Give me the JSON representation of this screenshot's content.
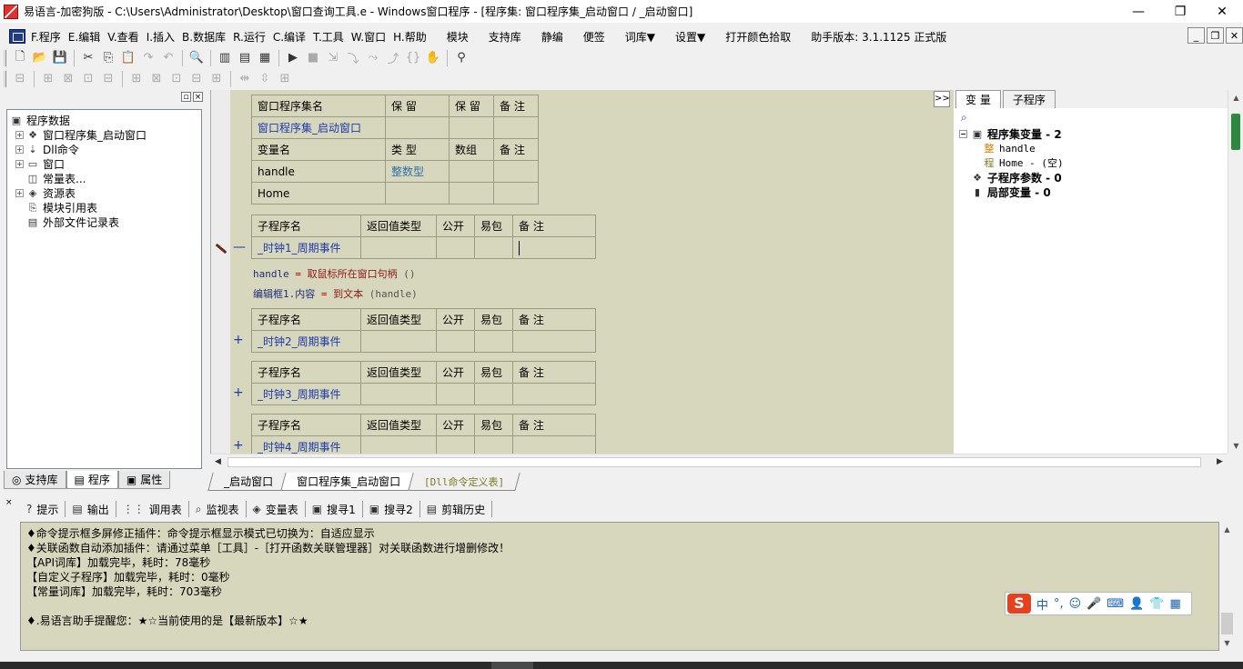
{
  "window": {
    "title": "易语言-加密狗版 - C:\\Users\\Administrator\\Desktop\\窗口查询工具.e - Windows窗口程序 - [程序集: 窗口程序集_启动窗口 / _启动窗口]",
    "min": "—",
    "max": "❐",
    "close": "✕"
  },
  "menu": {
    "items": [
      "F.程序",
      "E.编辑",
      "V.查看",
      "I.插入",
      "B.数据库",
      "R.运行",
      "C.编译",
      "T.工具",
      "W.窗口",
      "H.帮助"
    ],
    "extra": [
      "模块",
      "支持库",
      "静编",
      "便签",
      "词库▼",
      "设置▼",
      "打开颜色拾取",
      "助手版本: 3.1.1125 正式版"
    ],
    "mdi": [
      "_",
      "❐",
      "✕"
    ]
  },
  "left_panel": {
    "tree": [
      {
        "label": "程序数据",
        "icon": "program-data-icon",
        "glyph": "▣",
        "exp": ""
      },
      {
        "label": "窗口程序集_启动窗口",
        "icon": "assembly-icon",
        "glyph": "❖",
        "exp": "+"
      },
      {
        "label": "Dll命令",
        "icon": "dll-icon",
        "glyph": "⇣",
        "exp": "+"
      },
      {
        "label": "窗口",
        "icon": "window-icon",
        "glyph": "▭",
        "exp": "+"
      },
      {
        "label": "常量表...",
        "icon": "constant-icon",
        "glyph": "◫",
        "exp": ""
      },
      {
        "label": "资源表",
        "icon": "resource-icon",
        "glyph": "◈",
        "exp": "+"
      },
      {
        "label": "模块引用表",
        "icon": "module-icon",
        "glyph": "⎘",
        "exp": ""
      },
      {
        "label": "外部文件记录表",
        "icon": "file-record-icon",
        "glyph": "▤",
        "exp": ""
      }
    ],
    "tabs": [
      "支持库",
      "程序",
      "属性"
    ]
  },
  "code": {
    "assembly_header": [
      "窗口程序集名",
      "保 留",
      "保 留",
      "备 注"
    ],
    "assembly_name": "窗口程序集_启动窗口",
    "var_header": [
      "变量名",
      "类 型",
      "数组",
      "备 注"
    ],
    "vars": [
      {
        "name": "handle",
        "type": "整数型"
      },
      {
        "name": "Home",
        "type": ""
      }
    ],
    "sub_header": [
      "子程序名",
      "返回值类型",
      "公开",
      "易包",
      "备 注"
    ],
    "subs": [
      "_时钟1_周期事件",
      "_时钟2_周期事件",
      "_时钟3_周期事件",
      "_时钟4_周期事件"
    ],
    "line1": {
      "var": "handle",
      "op": "=",
      "fn": "取鼠标所在窗口句柄",
      "arg": "()"
    },
    "line2": {
      "var": "编辑框1.内容",
      "op": "=",
      "fn": "到文本",
      "arg": "(handle)"
    },
    "fold_minus": "—",
    "fold_plus": "+"
  },
  "right_panel": {
    "tabs": [
      "变 量",
      "子程序"
    ],
    "arrow": ">>",
    "search_icon": "⌕",
    "rows": [
      {
        "label": "程序集变量 - 2",
        "bold": true,
        "exp": "−",
        "glyph": "▣",
        "icon": "assembly-vars-icon"
      },
      {
        "label": "handle",
        "bold": false,
        "exp": "",
        "glyph": "整",
        "icon": "int-type-icon"
      },
      {
        "label": "Home - (空)",
        "bold": false,
        "exp": "",
        "glyph": "程",
        "icon": "program-type-icon"
      },
      {
        "label": "子程序参数 - 0",
        "bold": true,
        "exp": "",
        "glyph": "❖",
        "icon": "sub-params-icon"
      },
      {
        "label": "局部变量 - 0",
        "bold": true,
        "exp": "",
        "glyph": "▮",
        "icon": "local-vars-icon"
      }
    ]
  },
  "doc_tabs": [
    "_启动窗口",
    "窗口程序集_启动窗口",
    "[Dll命令定义表]"
  ],
  "bottom_tabs": [
    {
      "label": "提示",
      "glyph": "?",
      "icon": "hint-icon"
    },
    {
      "label": "输出",
      "glyph": "▤",
      "icon": "output-icon"
    },
    {
      "label": "调用表",
      "glyph": "⋮⋮",
      "icon": "call-table-icon"
    },
    {
      "label": "监视表",
      "glyph": "⌕",
      "icon": "watch-icon"
    },
    {
      "label": "变量表",
      "glyph": "◈",
      "icon": "var-table-icon"
    },
    {
      "label": "搜寻1",
      "glyph": "▣",
      "icon": "search1-icon"
    },
    {
      "label": "搜寻2",
      "glyph": "▣",
      "icon": "search2-icon"
    },
    {
      "label": "剪辑历史",
      "glyph": "▤",
      "icon": "clip-history-icon"
    }
  ],
  "output_lines": [
    "♦命令提示框多屏修正插件：命令提示框显示模式已切换为：自适应显示",
    "♦关联函数自动添加插件：请通过菜单［工具］-［打开函数关联管理器］对关联函数进行增删修改！",
    "【API词库】加载完毕，耗时：78毫秒",
    "【自定义子程序】加载完毕，耗时：0毫秒",
    "【常量词库】加载完毕，耗时：703毫秒",
    "",
    "♦.易语言助手提醒您：★☆当前使用的是【最新版本】☆★"
  ],
  "ime": {
    "logo": "S",
    "items": [
      "中",
      "°,",
      "☺",
      "🎤",
      "⌨",
      "👤",
      "👕",
      "▦"
    ]
  }
}
